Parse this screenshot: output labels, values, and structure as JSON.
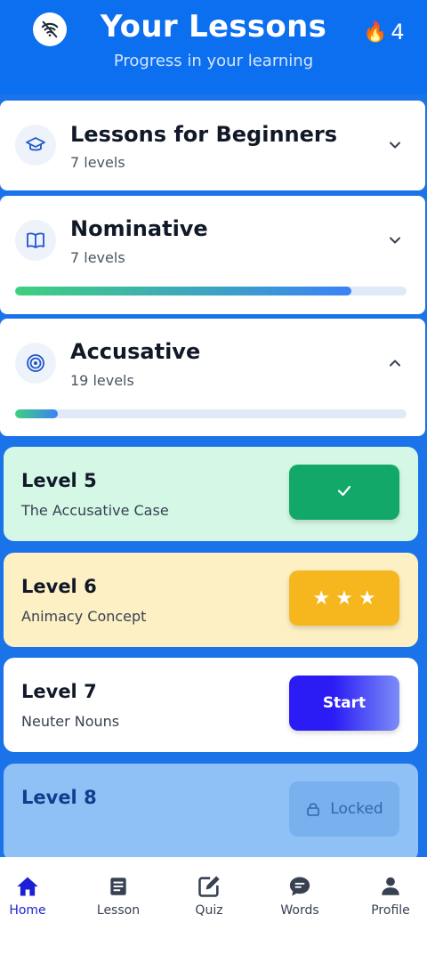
{
  "header": {
    "title": "Your Lessons",
    "subtitle": "Progress in your learning",
    "streak_count": "4",
    "streak_icon": "fire-icon",
    "status_icon": "no-wifi-icon"
  },
  "sections": [
    {
      "title": "Lessons for Beginners",
      "subtitle": "7 levels",
      "icon": "graduation-cap-icon",
      "expanded": false
    },
    {
      "title": "Nominative",
      "subtitle": "7 levels",
      "icon": "book-icon",
      "expanded": false,
      "progress": 0.86
    },
    {
      "title": "Accusative",
      "subtitle": "19 levels",
      "icon": "target-icon",
      "expanded": true,
      "progress": 0.11
    }
  ],
  "levels": [
    {
      "title": "Level 5",
      "subtitle": "The Accusative Case",
      "state": "completed",
      "button_icon": "check-icon",
      "bg": "#d5f7e6",
      "btn": "#12a86a"
    },
    {
      "title": "Level 6",
      "subtitle": "Animacy Concept",
      "state": "stars",
      "stars": 3,
      "bg": "#fdf0c4",
      "btn": "#f6b71e"
    },
    {
      "title": "Level 7",
      "subtitle": "Neuter Nouns",
      "state": "start",
      "button_label": "Start",
      "bg": "#ffffff",
      "btn": "#2b1cf5"
    },
    {
      "title": "Level 8",
      "subtitle": "",
      "state": "locked",
      "button_label": "Locked",
      "button_icon": "lock-icon",
      "bg": "#8fc1f6",
      "btn": "#79b0ee"
    }
  ],
  "nav": [
    {
      "label": "Home",
      "icon": "home-icon",
      "active": true
    },
    {
      "label": "Lesson",
      "icon": "document-icon",
      "active": false
    },
    {
      "label": "Quiz",
      "icon": "edit-icon",
      "active": false
    },
    {
      "label": "Words",
      "icon": "chat-icon",
      "active": false
    },
    {
      "label": "Profile",
      "icon": "person-icon",
      "active": false
    }
  ],
  "colors": {
    "header_bg": "#0b6ff0",
    "page_bg": "#1a73e8",
    "nav_active": "#1d1fd6"
  }
}
